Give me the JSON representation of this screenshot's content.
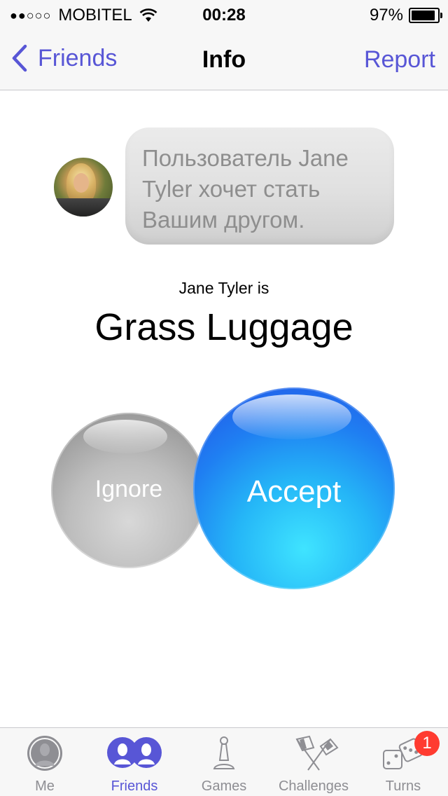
{
  "status_bar": {
    "signal_dots": "●●○○○",
    "carrier": "MOBITEL",
    "time": "00:28",
    "battery": "97%",
    "battery_level": 0.97
  },
  "nav": {
    "back_label": "Friends",
    "title": "Info",
    "report_label": "Report"
  },
  "message": {
    "text": "Пользователь Jane Tyler хочет стать Вашим другом."
  },
  "profile": {
    "subtitle": "Jane Tyler is",
    "name": "Grass Luggage"
  },
  "actions": {
    "ignore_label": "Ignore",
    "accept_label": "Accept"
  },
  "tabs": [
    {
      "label": "Me",
      "icon": "person-icon",
      "active": false
    },
    {
      "label": "Friends",
      "icon": "friends-icon",
      "active": true
    },
    {
      "label": "Games",
      "icon": "pawn-icon",
      "active": false
    },
    {
      "label": "Challenges",
      "icon": "flags-icon",
      "active": false
    },
    {
      "label": "Turns",
      "icon": "dice-icon",
      "active": false,
      "badge": "1"
    }
  ],
  "colors": {
    "accent": "#5856d6",
    "badge": "#ff3b30",
    "accept": "#1f7ff2",
    "ignore": "#b5b5b5"
  }
}
